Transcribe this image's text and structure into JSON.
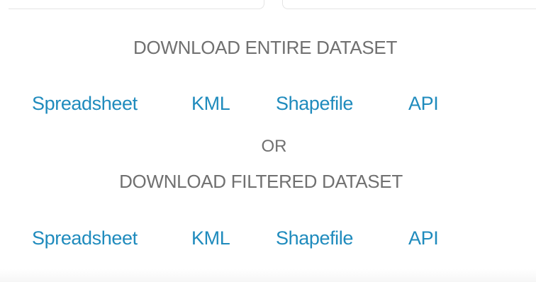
{
  "entire_section": {
    "heading": "DOWNLOAD ENTIRE DATASET",
    "links": [
      {
        "label": "Spreadsheet"
      },
      {
        "label": "KML"
      },
      {
        "label": "Shapefile"
      },
      {
        "label": "API"
      }
    ]
  },
  "separator": {
    "label": "OR"
  },
  "filtered_section": {
    "heading": "DOWNLOAD FILTERED DATASET",
    "links": [
      {
        "label": "Spreadsheet"
      },
      {
        "label": "KML"
      },
      {
        "label": "Shapefile"
      },
      {
        "label": "API"
      }
    ]
  },
  "colors": {
    "link": "#1f8bbd",
    "heading": "#707070",
    "background": "#ffffff"
  }
}
